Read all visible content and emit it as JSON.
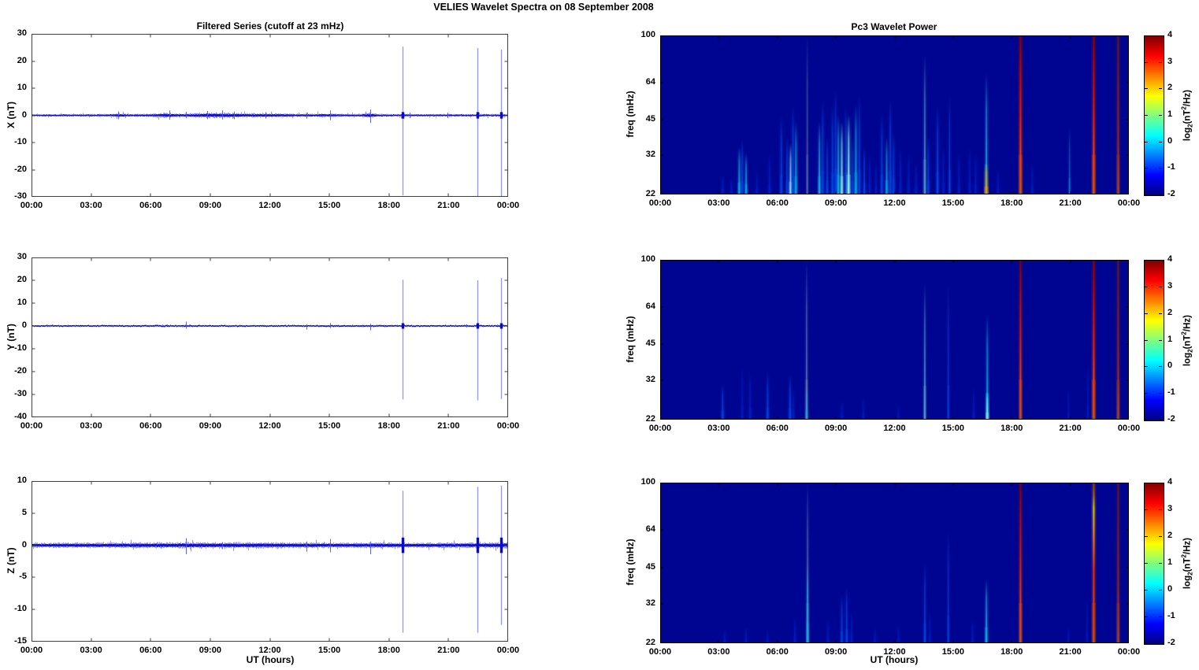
{
  "figure": {
    "title": "VELIES Wavelet Spectra on 08 September 2008",
    "background": "#ffffff"
  },
  "x_axis": {
    "tick_hours": [
      0,
      3,
      6,
      9,
      12,
      15,
      18,
      21,
      24
    ],
    "tick_labels": [
      "00:00",
      "03:00",
      "06:00",
      "09:00",
      "12:00",
      "15:00",
      "18:00",
      "21:00",
      "00:00"
    ],
    "label": "UT (hours)"
  },
  "colorbar": {
    "tick_values": [
      4,
      3,
      2,
      1,
      0,
      -1,
      -2
    ],
    "tick_labels": [
      "4",
      "3",
      "2",
      "1",
      "0",
      "-1",
      "-2"
    ],
    "range": [
      -2,
      4
    ],
    "label_parts": {
      "pre": "log",
      "sub": "2",
      "mid": "(nT",
      "sup": "2",
      "post": "/Hz)"
    },
    "gradient_stops": [
      "#000082",
      "#0000ff",
      "#00ffff",
      "#ffff00",
      "#ff0000",
      "#800000"
    ]
  },
  "palette": {
    "bg": "#000591",
    "b1": "#0020cc",
    "b2": "#0048e6",
    "cy": "#00b4e6",
    "cb": "#8cf0f0",
    "gr": "#7890b4",
    "tg": "#58aac8",
    "or": "#f09600",
    "noise_soft": "rgba(40,40,235,0.5)",
    "noise_core": "rgba(10,10,215,0.95)",
    "spike": "rgba(130,130,246,0.85)",
    "spike_minor": "rgba(80,80,242,0.9)",
    "spike_core": "rgba(8,8,210,1)",
    "ts_frame": "#3f3f3f",
    "wl_frame": "#000000"
  },
  "event_gradients": {
    "ev1": [
      [
        0,
        "#d75000"
      ],
      [
        0.22,
        "#ea3c00"
      ],
      [
        0.5,
        "#da1800"
      ],
      [
        0.78,
        "#b20500"
      ],
      [
        1,
        "#7d0000"
      ]
    ],
    "ev2": [
      [
        0,
        "#b4461e"
      ],
      [
        0.35,
        "#9c2313"
      ],
      [
        0.7,
        "#7c1919"
      ],
      [
        1,
        "#5f1616"
      ]
    ],
    "ev3": [
      [
        0,
        "#cd4b00"
      ],
      [
        0.45,
        "#dc2800"
      ],
      [
        0.72,
        "#e08c14"
      ],
      [
        0.84,
        "#cdb400"
      ],
      [
        0.92,
        "#a55a0a"
      ],
      [
        1,
        "#8c3200"
      ]
    ]
  },
  "chart_data": [
    {
      "type": "line",
      "id": "ts-x",
      "title": "Filtered Series (cutoff at 23 mHz)",
      "ylabel": "X (nT)",
      "xlabel": "",
      "ylim": [
        -30,
        30
      ],
      "yticks": [
        30,
        20,
        10,
        0,
        -10,
        -20,
        -30
      ],
      "noise_profile": [
        [
          0,
          0.35
        ],
        [
          2,
          0.38
        ],
        [
          4,
          0.45
        ],
        [
          4.4,
          0.7
        ],
        [
          4.8,
          0.45
        ],
        [
          6,
          0.5
        ],
        [
          6.9,
          0.8
        ],
        [
          7.4,
          0.55
        ],
        [
          8,
          0.6
        ],
        [
          8.8,
          0.85
        ],
        [
          9.6,
          0.8
        ],
        [
          10.2,
          0.8
        ],
        [
          11,
          0.65
        ],
        [
          11.8,
          0.7
        ],
        [
          12.5,
          0.6
        ],
        [
          13.5,
          0.5
        ],
        [
          14.2,
          0.55
        ],
        [
          15,
          0.6
        ],
        [
          15.5,
          0.45
        ],
        [
          16.5,
          0.45
        ],
        [
          17.05,
          0.85
        ],
        [
          17.4,
          0.45
        ],
        [
          18,
          0.4
        ],
        [
          19,
          0.42
        ],
        [
          20,
          0.38
        ],
        [
          21,
          0.42
        ],
        [
          22,
          0.38
        ],
        [
          23,
          0.4
        ],
        [
          24,
          0.45
        ]
      ],
      "spikes": [
        {
          "t": 18.7,
          "up": 25.3,
          "down": -29.5
        },
        {
          "t": 22.45,
          "up": 24.8,
          "down": -31
        },
        {
          "t": 23.64,
          "up": 24.2,
          "down": -31
        }
      ],
      "minor_spikes": [
        {
          "t": 4.35,
          "up": 1.4,
          "down": -1.4
        },
        {
          "t": 6.95,
          "up": 1.8,
          "down": -1.6
        },
        {
          "t": 7.78,
          "up": 1.3,
          "down": -1.1
        },
        {
          "t": 8.85,
          "up": 1.6,
          "down": -1.4
        },
        {
          "t": 9.6,
          "up": 1.8,
          "down": -1.5
        },
        {
          "t": 10.2,
          "up": 1.4,
          "down": -1.4
        },
        {
          "t": 11.8,
          "up": 1.2,
          "down": -1.2
        },
        {
          "t": 13.85,
          "up": 1.0,
          "down": -1.2
        },
        {
          "t": 15.02,
          "up": 1.8,
          "down": -1.8
        },
        {
          "t": 17.05,
          "up": 2.2,
          "down": -2.8
        },
        {
          "t": 19.05,
          "up": 1.0,
          "down": -1.0
        },
        {
          "t": 20.95,
          "up": 1.0,
          "down": -1.0
        }
      ]
    },
    {
      "type": "line",
      "id": "ts-y",
      "title": "",
      "ylabel": "Y (nT)",
      "xlabel": "",
      "ylim": [
        -40,
        30
      ],
      "yticks": [
        30,
        20,
        10,
        0,
        -10,
        -20,
        -30,
        -40
      ],
      "noise_profile": [
        [
          0,
          0.22
        ],
        [
          2,
          0.25
        ],
        [
          4,
          0.27
        ],
        [
          6,
          0.28
        ],
        [
          7.8,
          0.3
        ],
        [
          9,
          0.25
        ],
        [
          11,
          0.24
        ],
        [
          13,
          0.25
        ],
        [
          15,
          0.28
        ],
        [
          17,
          0.3
        ],
        [
          19,
          0.24
        ],
        [
          21,
          0.24
        ],
        [
          23,
          0.26
        ],
        [
          24,
          0.3
        ]
      ],
      "spikes": [
        {
          "t": 18.7,
          "up": 20.2,
          "down": -32.2
        },
        {
          "t": 22.45,
          "up": 20.0,
          "down": -32.6
        },
        {
          "t": 23.64,
          "up": 21.0,
          "down": -32.0
        }
      ],
      "minor_spikes": [
        {
          "t": 7.78,
          "up": 1.9,
          "down": -1.2
        },
        {
          "t": 13.85,
          "up": 0.8,
          "down": -1.6
        },
        {
          "t": 15.02,
          "up": 1.3,
          "down": -0.9
        },
        {
          "t": 17.05,
          "up": 1.0,
          "down": -1.9
        },
        {
          "t": 21.9,
          "up": 0.7,
          "down": -0.7
        }
      ]
    },
    {
      "type": "line",
      "id": "ts-z",
      "title": "",
      "ylabel": "Z (nT)",
      "xlabel": "UT (hours)",
      "ylim": [
        -15,
        10
      ],
      "yticks": [
        10,
        5,
        0,
        -5,
        -10,
        -15
      ],
      "noise_profile": [
        [
          0,
          0.32
        ],
        [
          2,
          0.34
        ],
        [
          4,
          0.36
        ],
        [
          6,
          0.38
        ],
        [
          8,
          0.4
        ],
        [
          10,
          0.4
        ],
        [
          12,
          0.38
        ],
        [
          14,
          0.36
        ],
        [
          16,
          0.34
        ],
        [
          18,
          0.36
        ],
        [
          20,
          0.34
        ],
        [
          22,
          0.36
        ],
        [
          24,
          0.4
        ]
      ],
      "spikes": [
        {
          "t": 18.7,
          "up": 8.5,
          "down": -13.6
        },
        {
          "t": 22.45,
          "up": 9.1,
          "down": -13.6
        },
        {
          "t": 23.64,
          "up": 9.3,
          "down": -12.4
        }
      ],
      "minor_spikes": [
        {
          "t": 7.78,
          "up": 1.1,
          "down": -1.4
        },
        {
          "t": 9.6,
          "up": 0.5,
          "down": -0.6
        },
        {
          "t": 13.85,
          "up": 0.6,
          "down": -1.0
        },
        {
          "t": 15.02,
          "up": 1.0,
          "down": -1.1
        },
        {
          "t": 17.05,
          "up": 0.6,
          "down": -1.4
        }
      ]
    },
    {
      "type": "heatmap",
      "id": "wl-x",
      "title": "Pc3 Wavelet Power",
      "ylabel": "freq (mHz)",
      "xlabel": "",
      "yscale": "log",
      "ylim": [
        22,
        100
      ],
      "yticks": [
        100,
        64,
        45,
        32,
        22
      ],
      "streaks": [
        [
          3.2,
          0.12,
          "b1",
          2,
          0.8
        ],
        [
          3.65,
          0.1,
          "b1",
          2,
          0.7
        ],
        [
          4.05,
          0.3,
          "cy",
          2,
          0.9
        ],
        [
          4.2,
          0.34,
          "b2",
          2,
          0.9
        ],
        [
          4.4,
          0.26,
          "cy",
          2,
          0.85
        ],
        [
          4.95,
          0.14,
          "b1",
          2,
          0.7
        ],
        [
          5.6,
          0.26,
          "b1",
          2,
          0.8
        ],
        [
          6.2,
          0.5,
          "b2",
          2,
          0.85
        ],
        [
          6.5,
          0.36,
          "b2",
          2,
          0.8
        ],
        [
          6.68,
          0.32,
          "cb",
          2,
          0.95
        ],
        [
          6.8,
          0.56,
          "b2",
          2,
          0.9
        ],
        [
          6.95,
          0.46,
          "cy",
          2,
          0.85
        ],
        [
          7.53,
          1.0,
          "gr",
          1.5,
          0.55
        ],
        [
          8.15,
          0.46,
          "cy",
          2,
          0.9
        ],
        [
          8.32,
          0.6,
          "b2",
          2,
          0.85
        ],
        [
          8.55,
          0.36,
          "b2",
          2,
          0.8
        ],
        [
          8.82,
          0.56,
          "b2",
          2,
          0.9
        ],
        [
          8.98,
          0.66,
          "b2",
          2,
          0.85
        ],
        [
          9.12,
          0.5,
          "cy",
          2,
          0.9
        ],
        [
          9.3,
          0.46,
          "cb",
          2,
          0.95
        ],
        [
          9.5,
          0.56,
          "b2",
          2,
          0.85
        ],
        [
          9.65,
          0.5,
          "cb",
          2.5,
          0.95
        ],
        [
          9.85,
          0.36,
          "b2",
          2,
          0.8
        ],
        [
          10.02,
          0.56,
          "cy",
          2,
          0.9
        ],
        [
          10.2,
          0.62,
          "b2",
          2,
          0.85
        ],
        [
          10.45,
          0.3,
          "b2",
          2,
          0.8
        ],
        [
          10.72,
          0.26,
          "b1",
          2,
          0.75
        ],
        [
          11.05,
          0.2,
          "b1",
          2,
          0.7
        ],
        [
          11.35,
          0.5,
          "b2",
          2,
          0.85
        ],
        [
          11.6,
          0.36,
          "cy",
          2,
          0.85
        ],
        [
          11.78,
          0.6,
          "b2",
          2,
          0.85
        ],
        [
          11.95,
          0.4,
          "b2",
          2,
          0.8
        ],
        [
          12.3,
          0.3,
          "b1",
          2,
          0.75
        ],
        [
          12.72,
          0.26,
          "b1",
          2,
          0.7
        ],
        [
          13.1,
          0.2,
          "b1",
          2,
          0.7
        ],
        [
          13.55,
          0.88,
          "tg",
          2,
          0.75
        ],
        [
          13.72,
          0.36,
          "b2",
          2,
          0.8
        ],
        [
          14.2,
          0.56,
          "b2",
          2,
          0.85
        ],
        [
          14.5,
          0.3,
          "b1",
          2,
          0.75
        ],
        [
          14.82,
          0.62,
          "b2",
          1.5,
          0.85
        ],
        [
          15.3,
          0.26,
          "b1",
          2,
          0.7
        ],
        [
          15.85,
          0.3,
          "b1",
          2,
          0.7
        ],
        [
          16.15,
          0.26,
          "b1",
          2,
          0.7
        ],
        [
          16.7,
          0.76,
          "cy",
          2,
          0.9
        ],
        [
          16.7,
          0.2,
          "or",
          2.5,
          0.9
        ],
        [
          17.3,
          0.16,
          "b1",
          2,
          0.6
        ],
        [
          19.05,
          0.2,
          "b1",
          2,
          0.6
        ],
        [
          20.96,
          0.42,
          "cy",
          1.5,
          0.5
        ],
        [
          18.45,
          1.0,
          "ev1",
          2.2,
          1
        ],
        [
          22.2,
          1.0,
          "ev1",
          2.2,
          1
        ],
        [
          23.45,
          1.0,
          "ev2",
          2,
          0.9
        ]
      ]
    },
    {
      "type": "heatmap",
      "id": "wl-y",
      "title": "",
      "ylabel": "freq (mHz)",
      "xlabel": "",
      "yscale": "log",
      "ylim": [
        22,
        100
      ],
      "yticks": [
        100,
        64,
        45,
        32,
        22
      ],
      "streaks": [
        [
          3.2,
          0.22,
          "b2",
          2,
          0.85
        ],
        [
          4.2,
          0.33,
          "b1",
          2,
          0.6
        ],
        [
          4.6,
          0.3,
          "b1",
          2,
          0.7
        ],
        [
          5.5,
          0.3,
          "b2",
          2,
          0.8
        ],
        [
          6.65,
          0.28,
          "b2",
          2,
          0.85
        ],
        [
          6.82,
          0.2,
          "b1",
          2,
          0.7
        ],
        [
          7.5,
          1.0,
          "gr",
          1.8,
          0.7
        ],
        [
          7.5,
          0.2,
          "cy",
          1.8,
          0.6
        ],
        [
          9.3,
          0.12,
          "b1",
          2,
          0.6
        ],
        [
          10.4,
          0.15,
          "b1",
          2,
          0.55
        ],
        [
          12.2,
          0.1,
          "b1",
          2,
          0.5
        ],
        [
          13.55,
          0.85,
          "tg",
          1.8,
          0.8
        ],
        [
          14.75,
          0.85,
          "b2",
          1.5,
          0.7
        ],
        [
          16.05,
          0.2,
          "b1",
          2,
          0.6
        ],
        [
          16.75,
          0.66,
          "cy",
          2,
          0.9
        ],
        [
          16.75,
          0.18,
          "cb",
          2,
          0.8
        ],
        [
          20.9,
          0.2,
          "b1",
          1.5,
          0.5
        ],
        [
          21.9,
          0.35,
          "b1",
          1.5,
          0.6
        ],
        [
          18.45,
          1.0,
          "ev1",
          2,
          0.95
        ],
        [
          22.2,
          1.0,
          "ev1",
          2.2,
          1
        ],
        [
          23.45,
          1.0,
          "ev2",
          2,
          0.9
        ]
      ]
    },
    {
      "type": "heatmap",
      "id": "wl-z",
      "title": "",
      "ylabel": "freq (mHz)",
      "xlabel": "UT (hours)",
      "yscale": "log",
      "ylim": [
        22,
        100
      ],
      "yticks": [
        100,
        64,
        45,
        32,
        22
      ],
      "streaks": [
        [
          3.3,
          0.08,
          "b1",
          2,
          0.6
        ],
        [
          4.4,
          0.1,
          "b1",
          2,
          0.6
        ],
        [
          5.5,
          0.08,
          "b1",
          2,
          0.55
        ],
        [
          6.9,
          0.16,
          "b1",
          2,
          0.7
        ],
        [
          7.55,
          1.0,
          "gr",
          1.8,
          0.7
        ],
        [
          7.55,
          0.5,
          "cy",
          1.8,
          0.8
        ],
        [
          8.6,
          0.15,
          "b1",
          2,
          0.6
        ],
        [
          9.3,
          0.3,
          "b2",
          2,
          0.8
        ],
        [
          9.55,
          0.35,
          "b2",
          2,
          0.8
        ],
        [
          9.8,
          0.2,
          "b1",
          2,
          0.7
        ],
        [
          11.0,
          0.1,
          "b1",
          2,
          0.55
        ],
        [
          12.2,
          0.12,
          "b1",
          2,
          0.55
        ],
        [
          13.55,
          0.5,
          "b2",
          1.8,
          0.8
        ],
        [
          13.8,
          0.2,
          "b1",
          2,
          0.6
        ],
        [
          14.75,
          0.7,
          "b2",
          1.5,
          0.75
        ],
        [
          16.0,
          0.15,
          "b1",
          2,
          0.6
        ],
        [
          16.7,
          0.4,
          "cy",
          2,
          0.9
        ],
        [
          20.9,
          0.1,
          "b1",
          1.5,
          0.5
        ],
        [
          21.85,
          0.3,
          "b1",
          1.5,
          0.5
        ],
        [
          18.45,
          1.0,
          "ev1",
          2,
          0.95
        ],
        [
          22.2,
          1.0,
          "ev3",
          2.2,
          1
        ],
        [
          23.45,
          1.0,
          "ev2",
          2,
          0.85
        ]
      ]
    }
  ]
}
